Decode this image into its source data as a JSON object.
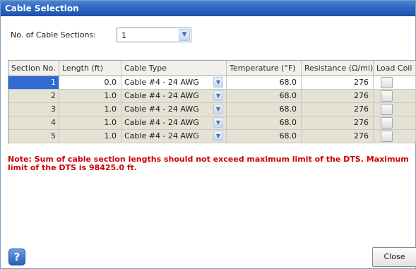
{
  "window": {
    "title": "Cable Selection"
  },
  "sections": {
    "label": "No. of Cable Sections:",
    "value": "1"
  },
  "table": {
    "headers": [
      "Section No.",
      "Length (ft)",
      "Cable Type",
      "Temperature (°F)",
      "Resistance (Ω/mi)",
      "Load Coil"
    ],
    "rows": [
      {
        "section": "1",
        "length": "0.0",
        "cable_type": "Cable #4 - 24 AWG",
        "temperature": "68.0",
        "resistance": "276",
        "load_coil": false
      },
      {
        "section": "2",
        "length": "1.0",
        "cable_type": "Cable #4 - 24 AWG",
        "temperature": "68.0",
        "resistance": "276",
        "load_coil": false
      },
      {
        "section": "3",
        "length": "1.0",
        "cable_type": "Cable #4 - 24 AWG",
        "temperature": "68.0",
        "resistance": "276",
        "load_coil": false
      },
      {
        "section": "4",
        "length": "1.0",
        "cable_type": "Cable #4 - 24 AWG",
        "temperature": "68.0",
        "resistance": "276",
        "load_coil": false
      },
      {
        "section": "5",
        "length": "1.0",
        "cable_type": "Cable #4 - 24 AWG",
        "temperature": "68.0",
        "resistance": "276",
        "load_coil": false
      }
    ]
  },
  "note": "Note: Sum of cable section lengths should not exceed maximum limit of the DTS. Maximum limit of the DTS is 98425.0 ft.",
  "buttons": {
    "help": "?",
    "close": "Close"
  },
  "icons": {
    "help": "help-icon",
    "dropdown": "chevron-down-icon"
  },
  "colors": {
    "titlebar": "#2e68c4",
    "selection": "#2f6bd0",
    "note": "#cc0000",
    "row_disabled": "#e4e2d4"
  }
}
